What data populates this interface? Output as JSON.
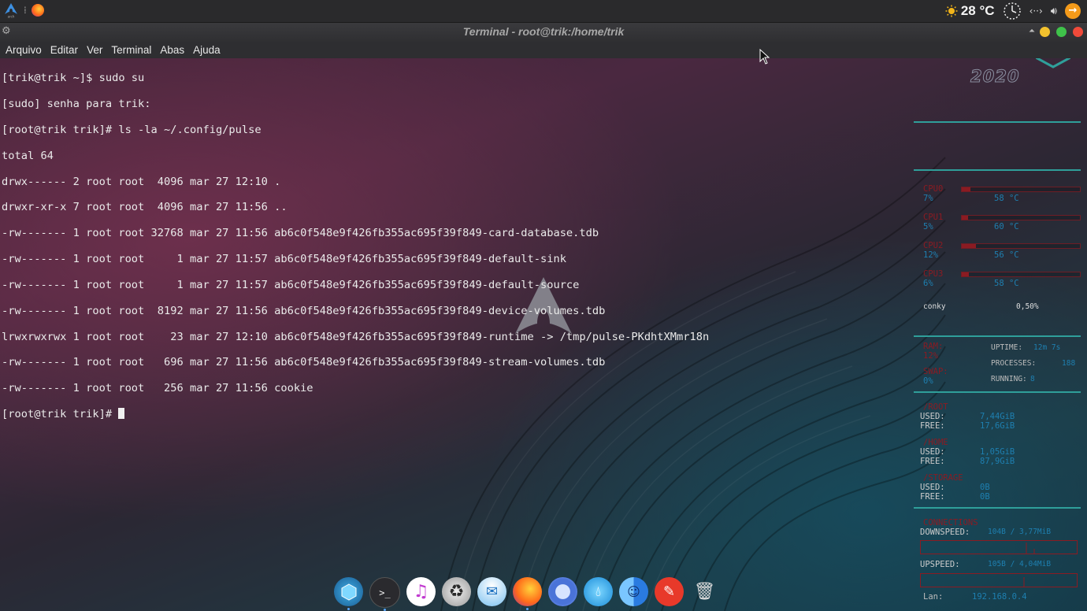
{
  "top_panel": {
    "weather": "28 °C",
    "icons": [
      "arch-logo-icon",
      "dots-menu-icon",
      "firefox-icon",
      "sun-icon",
      "clock-icon",
      "network-icon",
      "volume-icon",
      "update-icon"
    ]
  },
  "window": {
    "title": "Terminal - root@trik:/home/trik",
    "menu": [
      "Arquivo",
      "Editar",
      "Ver",
      "Terminal",
      "Abas",
      "Ajuda"
    ]
  },
  "terminal": {
    "lines": [
      "[trik@trik ~]$ sudo su",
      "[sudo] senha para trik:",
      "[root@trik trik]# ls -la ~/.config/pulse",
      "total 64",
      "drwx------ 2 root root  4096 mar 27 12:10 .",
      "drwxr-xr-x 7 root root  4096 mar 27 11:56 ..",
      "-rw------- 1 root root 32768 mar 27 11:56 ab6c0f548e9f426fb355ac695f39f849-card-database.tdb",
      "-rw------- 1 root root     1 mar 27 11:57 ab6c0f548e9f426fb355ac695f39f849-default-sink",
      "-rw------- 1 root root     1 mar 27 11:57 ab6c0f548e9f426fb355ac695f39f849-default-source",
      "-rw------- 1 root root  8192 mar 27 11:56 ab6c0f548e9f426fb355ac695f39f849-device-volumes.tdb",
      "lrwxrwxrwx 1 root root    23 mar 27 12:10 ab6c0f548e9f426fb355ac695f39f849-runtime -> /tmp/pulse-PKdhtXMmr18n",
      "-rw------- 1 root root   696 mar 27 11:56 ab6c0f548e9f426fb355ac695f39f849-stream-volumes.tdb",
      "-rw------- 1 root root   256 mar 27 11:56 cookie"
    ],
    "prompt": "[root@trik trik]# "
  },
  "conky": {
    "year": "2020",
    "cpus": [
      {
        "label": "CPU0",
        "pct": "7%",
        "temp": "58 °C",
        "fill": 0.07
      },
      {
        "label": "CPU1",
        "pct": "5%",
        "temp": "60 °C",
        "fill": 0.05
      },
      {
        "label": "CPU2",
        "pct": "12%",
        "temp": "56 °C",
        "fill": 0.12
      },
      {
        "label": "CPU3",
        "pct": "6%",
        "temp": "58 °C",
        "fill": 0.06
      }
    ],
    "proc_value": "0,50%",
    "proc_name": "conky",
    "ram_label": "RAM:",
    "ram_pct": "12%",
    "swap_label": "SWAP:",
    "swap_pct": "0%",
    "uptime_label": "UPTIME:",
    "uptime_value": "12m 7s",
    "processes_label": "PROCESSES:",
    "processes_value": "188",
    "running_label": "RUNNING:",
    "running_value": "8",
    "disks": [
      {
        "name": "/ROOT",
        "used": "7,44GiB",
        "free": "17,6GiB"
      },
      {
        "name": "/HOME",
        "used": "1,05GiB",
        "free": "87,9GiB"
      },
      {
        "name": "/STORAGE",
        "used": "0B",
        "free": "0B"
      }
    ],
    "used_label": "USED:",
    "free_label": "FREE:",
    "connections": "CONNECTIONS",
    "downspeed_label": "DOWNSPEED:",
    "downspeed_value": "104B / 3,77MiB",
    "upspeed_label": "UPSPEED:",
    "upspeed_value": "105B / 4,04MiB",
    "lan_label": "Lan:",
    "lan_value": "192.168.0.4"
  },
  "dock": {
    "items": [
      "app-icon",
      "terminal-icon",
      "music-icon",
      "recycle-icon",
      "mail-icon",
      "firefox-icon",
      "browser-icon",
      "water-drop-icon",
      "finder-icon",
      "text-editor-icon",
      "trash-icon"
    ]
  },
  "colors": {
    "conky_red": "#8b1b22",
    "conky_blue": "#1e7fb0",
    "conky_line": "#2f9f9a"
  }
}
